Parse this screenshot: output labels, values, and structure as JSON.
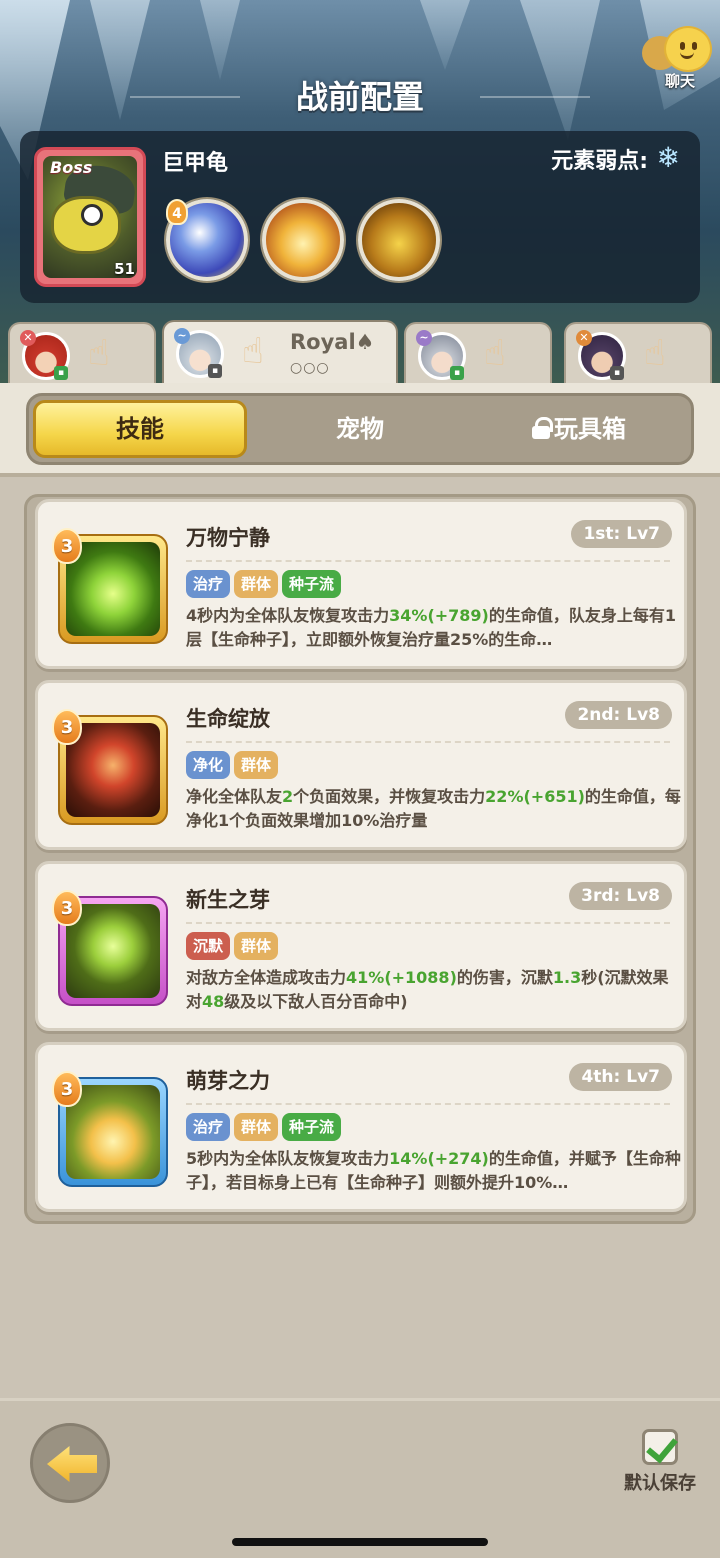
{
  "header": {
    "title": "战前配置",
    "chat_label": "聊天"
  },
  "boss": {
    "tag": "Boss",
    "level": "51",
    "name": "巨甲龟",
    "weakness_label": "元素弱点:",
    "weakness_icon": "snowflake-icon",
    "skill_badge": "4"
  },
  "characters": [
    {
      "name": "red-hair-hero",
      "selected": false
    },
    {
      "name": "Royal♠",
      "dots": "○○○",
      "selected": true
    },
    {
      "name": "silver-hair-hero",
      "selected": false
    },
    {
      "name": "dark-hair-hero",
      "selected": false
    }
  ],
  "tabs": {
    "skills": "技能",
    "pets": "宠物",
    "toybox": "玩具箱"
  },
  "skills": [
    {
      "level_badge": "3",
      "name": "万物宁静",
      "rank": "1st: Lv7",
      "tags": [
        "治疗",
        "群体",
        "种子流"
      ],
      "desc": {
        "p1": "4秒内为全体队友恢复攻击力",
        "v1": "34%(+789)",
        "p2": "的生命值，队友身上每有1层【生命种子】，立即额外恢复治疗量25%的生命…"
      }
    },
    {
      "level_badge": "3",
      "name": "生命绽放",
      "rank": "2nd: Lv8",
      "tags": [
        "净化",
        "群体"
      ],
      "desc": {
        "p1": "净化全体队友",
        "v1": "2",
        "p2": "个负面效果，并恢复攻击力",
        "v2": "22%(+651)",
        "p3": "的生命值，每净化1个负面效果增加10%治疗量"
      }
    },
    {
      "level_badge": "3",
      "name": "新生之芽",
      "rank": "3rd: Lv8",
      "tags": [
        "沉默",
        "群体"
      ],
      "desc": {
        "p1": "对敌方全体造成攻击力",
        "v1": "41%(+1088)",
        "p2": "的伤害，沉默",
        "v2": "1.3",
        "p3": "秒(沉默效果对",
        "v3": "48",
        "p4": "级及以下敌人百分百命中)"
      }
    },
    {
      "level_badge": "3",
      "name": "萌芽之力",
      "rank": "4th: Lv7",
      "tags": [
        "治疗",
        "群体",
        "种子流"
      ],
      "desc": {
        "p1": "5秒内为全体队友恢复攻击力",
        "v1": "14%(+274)",
        "p2": "的生命值，并赋予【生命种子】，若目标身上已有【生命种子】则额外提升10%…"
      }
    }
  ],
  "footer": {
    "save_label": "默认保存",
    "save_checked": true
  }
}
